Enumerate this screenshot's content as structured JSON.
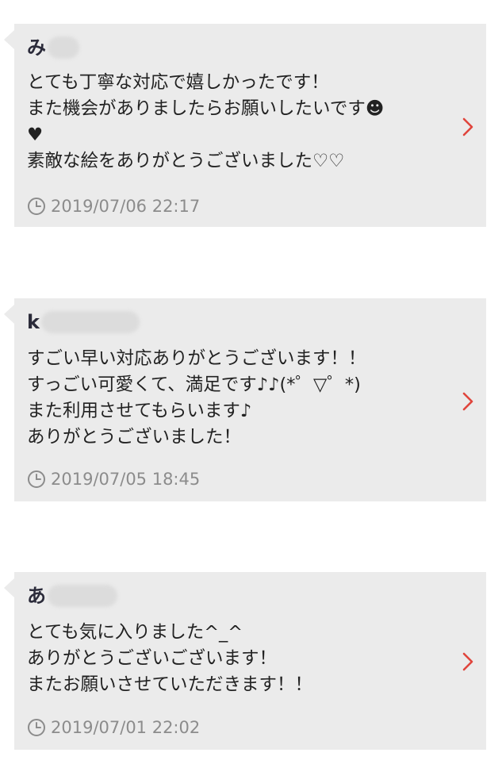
{
  "reviews": [
    {
      "name": "み",
      "lines": [
        "とても丁寧な対応で嬉しかったです！",
        "また機会がありましたらお願いしたいです☻",
        "♥",
        "素敵な絵をありがとうございました♡♡"
      ],
      "date": "2019/07/06 22:17"
    },
    {
      "name": "k",
      "lines": [
        "すごい早い対応ありがとうございます！！",
        "すっごい可愛くて、満足です♪♪(*゜▽゜*)",
        "また利用させてもらいます♪",
        "ありがとうございました！"
      ],
      "date": "2019/07/05 18:45"
    },
    {
      "name": "あ",
      "lines": [
        "とても気に入りました^_^",
        "ありがとうございございます！",
        "またお願いさせていただきます！！"
      ],
      "date": "2019/07/01 22:02"
    }
  ],
  "colors": {
    "card_background": "#ebebeb",
    "chevron": "#e0453c",
    "date_text": "#8c8c8c"
  },
  "icons": {
    "date": "clock-icon",
    "open": "chevron-right-icon"
  }
}
